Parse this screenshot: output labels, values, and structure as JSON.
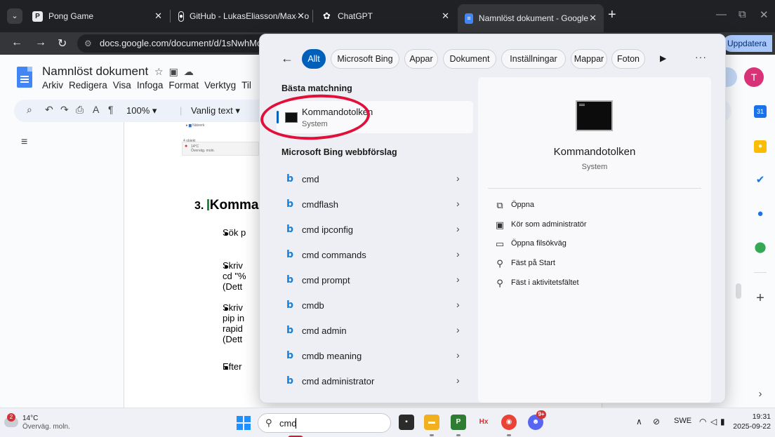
{
  "browser": {
    "tabs": [
      {
        "title": "Pong Game",
        "favicon": "P",
        "favicon_color": "#3c4043"
      },
      {
        "title": "GitHub - LukasEliasson/Max-Bo",
        "favicon": "github-icon",
        "favicon_color": "#ffffff"
      },
      {
        "title": "ChatGPT",
        "favicon": "chatgpt-icon",
        "favicon_color": "#ffffff"
      },
      {
        "title": "Namnlöst dokument - Google D",
        "favicon": "docs-icon",
        "favicon_color": "#4285f4"
      }
    ],
    "close_glyph": "✕",
    "new_tab": "+",
    "url": "docs.google.com/document/d/1sNwhMc6B",
    "update_label": "Uppdatera"
  },
  "docs": {
    "title": "Namnlöst dokument",
    "menu": [
      "Arkiv",
      "Redigera",
      "Visa",
      "Infoga",
      "Format",
      "Verktyg",
      "Til"
    ],
    "zoom": "100%",
    "style": "Vanlig text",
    "avatar_letter": "T",
    "thumbnail": {
      "network_label": "Nätverk",
      "count_label": "4 objekt",
      "weather_temp": "14°C",
      "weather_cond": "Överväg. moln."
    },
    "heading_number": "3.",
    "heading_text": "Komman",
    "lines": [
      "Sök p",
      "Skriv",
      "cd \"%",
      "(Dett",
      "Skriv",
      "pip in",
      "rapid",
      "(Dett",
      "Efter"
    ]
  },
  "search": {
    "filters": [
      "Allt",
      "Microsoft Bing",
      "Appar",
      "Dokument",
      "Inställningar",
      "Mappar",
      "Foton"
    ],
    "best_match_label": "Bästa matchning",
    "best_match": {
      "name": "Kommandotolken",
      "type": "System"
    },
    "bing_label": "Microsoft Bing webbförslag",
    "suggestions": [
      "cmd",
      "cmdflash",
      "cmd ipconfig",
      "cmd commands",
      "cmd prompt",
      "cmdb",
      "cmd admin",
      "cmdb meaning",
      "cmd administrator"
    ],
    "preview": {
      "name": "Kommandotolken",
      "type": "System",
      "actions": [
        {
          "icon": "open-icon",
          "label": "Öppna"
        },
        {
          "icon": "admin-shield-icon",
          "label": "Kör som administratör"
        },
        {
          "icon": "folder-icon",
          "label": "Öppna filsökväg"
        },
        {
          "icon": "pin-icon",
          "label": "Fäst på Start"
        },
        {
          "icon": "pin-icon",
          "label": "Fäst i aktivitetsfältet"
        }
      ]
    }
  },
  "taskbar": {
    "weather_badge": "2",
    "weather_temp": "14°C",
    "weather_cond": "Överväg. moln.",
    "search_text": "cmd",
    "app_badge": "9+",
    "language": "SWE",
    "time": "19:31",
    "date": "2025-09-22"
  }
}
